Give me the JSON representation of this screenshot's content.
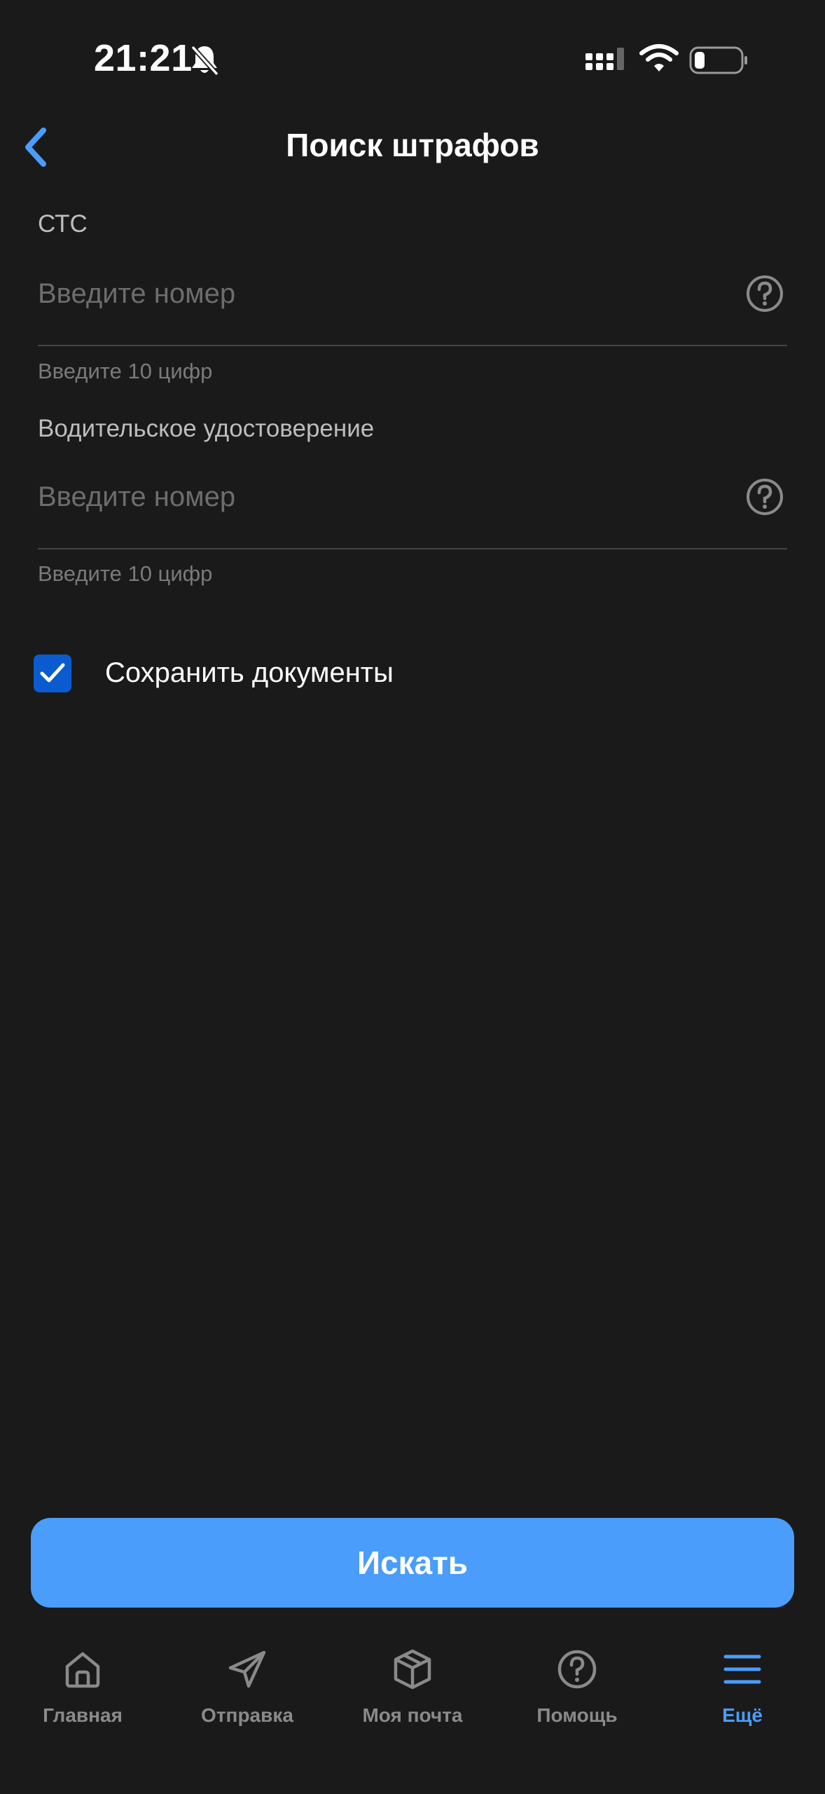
{
  "status_bar": {
    "time": "21:21"
  },
  "header": {
    "title": "Поиск штрафов"
  },
  "form": {
    "sts": {
      "label": "СТС",
      "placeholder": "Введите номер",
      "hint": "Введите 10 цифр"
    },
    "license": {
      "label": "Водительское удостоверение",
      "placeholder": "Введите номер",
      "hint": "Введите 10 цифр"
    },
    "save_documents": {
      "label": "Сохранить документы",
      "checked": true
    }
  },
  "search_button": {
    "label": "Искать"
  },
  "nav": {
    "items": [
      {
        "label": "Главная",
        "icon": "home-icon"
      },
      {
        "label": "Отправка",
        "icon": "paper-plane-icon"
      },
      {
        "label": "Моя почта",
        "icon": "package-icon"
      },
      {
        "label": "Помощь",
        "icon": "help-icon"
      },
      {
        "label": "Ещё",
        "icon": "menu-icon",
        "active": true
      }
    ]
  },
  "colors": {
    "background": "#1a1a1a",
    "accent": "#4a9dfa",
    "checkbox": "#0a5bd0"
  }
}
